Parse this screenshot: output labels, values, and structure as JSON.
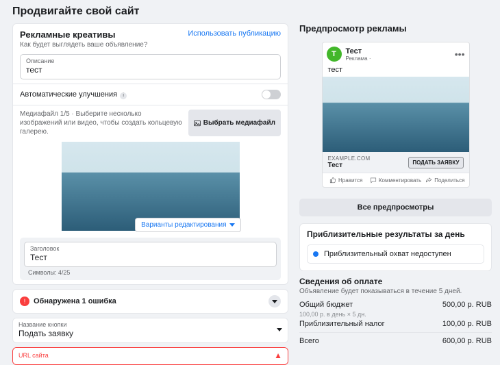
{
  "page_title": "Продвигайте свой сайт",
  "creatives": {
    "title": "Рекламные креативы",
    "subtitle": "Как будет выглядеть ваше объявление?",
    "use_post_link": "Использовать публикацию",
    "description_label": "Описание",
    "description_value": "тест",
    "auto_improve_label": "Автоматические улучшения",
    "media_counter": "Медиафайл 1/5 · Выберите несколько изображений или видео, чтобы создать кольцевую галерею.",
    "pick_media_btn": "Выбрать медиафайл",
    "edit_options_btn": "Варианты редактирования",
    "headline_label": "Заголовок",
    "headline_value": "Тест",
    "headline_counter": "Символы: 4/25",
    "error_banner": "Обнаружена 1 ошибка",
    "button_label_field": "Название кнопки",
    "button_value": "Подать заявку",
    "url_label": "URL сайта"
  },
  "preview": {
    "title": "Предпросмотр рекламы",
    "page_name": "Тест",
    "sponsor_line": "Реклама · ",
    "body_text": "тест",
    "domain": "EXAMPLE.COM",
    "headline": "Тест",
    "cta": "ПОДАТЬ ЗАЯВКУ",
    "like": "Нравится",
    "comment": "Комментировать",
    "share": "Поделиться",
    "all_btn": "Все предпросмотры"
  },
  "estimates": {
    "title": "Приблизительные результаты за день",
    "reach_unavailable": "Приблизительный охват недоступен"
  },
  "payment": {
    "title": "Сведения об оплате",
    "subtitle": "Объявление будет показываться в течение 5 дней.",
    "budget_label": "Общий бюджет",
    "budget_sub": "100,00 р. в день × 5 дн.",
    "budget_value": "500,00 р. RUB",
    "tax_label": "Приблизительный налог",
    "tax_value": "100,00 р. RUB",
    "total_label": "Всего",
    "total_value": "600,00 р. RUB"
  }
}
